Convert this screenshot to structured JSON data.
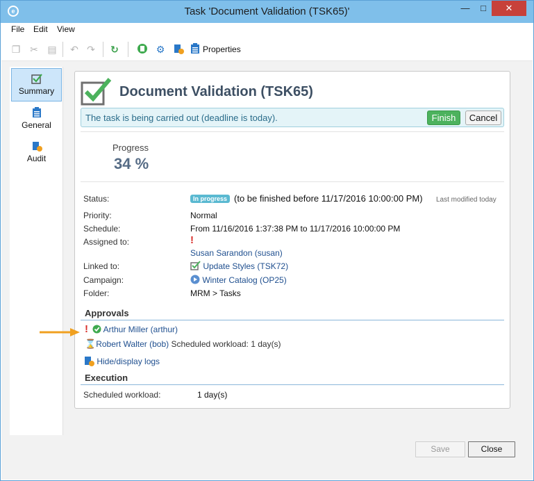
{
  "window": {
    "title": "Task 'Document Validation (TSK65)'"
  },
  "menu": {
    "file": "File",
    "edit": "Edit",
    "view": "View"
  },
  "toolbar": {
    "properties_label": "Properties"
  },
  "sidebar": {
    "items": [
      {
        "label": "Summary"
      },
      {
        "label": "General"
      },
      {
        "label": "Audit"
      }
    ]
  },
  "header": {
    "title": "Document Validation (TSK65)",
    "status_message": "The task is being carried out (deadline is today).",
    "finish_label": "Finish",
    "cancel_label": "Cancel"
  },
  "progress": {
    "label": "Progress",
    "value_text": "34 %"
  },
  "details": {
    "status_label": "Status:",
    "status_badge": "In progress",
    "status_text": "(to be finished before 11/17/2016 10:00:00 PM)",
    "last_modified": "Last modified today",
    "priority_label": "Priority:",
    "priority_value": "Normal",
    "schedule_label": "Schedule:",
    "schedule_value": "From 11/16/2016 1:37:38 PM to 11/17/2016 10:00:00 PM",
    "assigned_label": "Assigned to:",
    "assigned_value": "Susan Sarandon (susan)",
    "linked_label": "Linked to:",
    "linked_value": "Update Styles (TSK72)",
    "campaign_label": "Campaign:",
    "campaign_value": "Winter Catalog (OP25)",
    "folder_label": "Folder:",
    "folder_value": "MRM > Tasks"
  },
  "approvals": {
    "title": "Approvals",
    "first": "Arthur Miller (arthur)",
    "second_name": "Robert Walter (bob)",
    "second_workload": "Scheduled workload: 1 day(s)",
    "logs_link": "Hide/display logs"
  },
  "execution": {
    "title": "Execution",
    "workload_label": "Scheduled workload:",
    "workload_value": "1 day(s)"
  },
  "footer": {
    "save_label": "Save",
    "close_label": "Close"
  },
  "colors": {
    "accent": "#7fbfea",
    "finish": "#4cb25d",
    "link": "#1f4f8f"
  }
}
